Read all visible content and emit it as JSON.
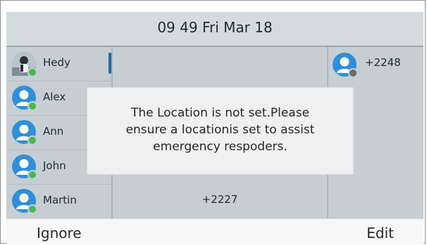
{
  "status_bar": {
    "datetime": "09 49 Fri Mar 18"
  },
  "contacts": [
    {
      "name": "Hedy",
      "avatar": "photo",
      "status_color": "#47b84e"
    },
    {
      "name": "Alex",
      "avatar": "person-icon",
      "status_color": "#47b84e"
    },
    {
      "name": "Ann",
      "avatar": "person-icon",
      "status_color": "#47b84e"
    },
    {
      "name": "John",
      "avatar": "person-icon",
      "status_color": "#47b84e"
    },
    {
      "name": "Martin",
      "avatar": "person-icon",
      "status_color": "#47b84e"
    }
  ],
  "middle_column": {
    "number": "+2227"
  },
  "right_column": {
    "number": "+2248",
    "status_color": "#6b6b6b"
  },
  "dialog": {
    "line1": "The Location is not set.Please",
    "line2": "ensure a locationis set to assist",
    "line3": "emergency respoders."
  },
  "softkeys": {
    "left": "Ignore",
    "right": "Edit"
  },
  "colors": {
    "accent": "#1f6aa8",
    "avatar_blue": "#2f8fd8",
    "online": "#47b84e"
  }
}
